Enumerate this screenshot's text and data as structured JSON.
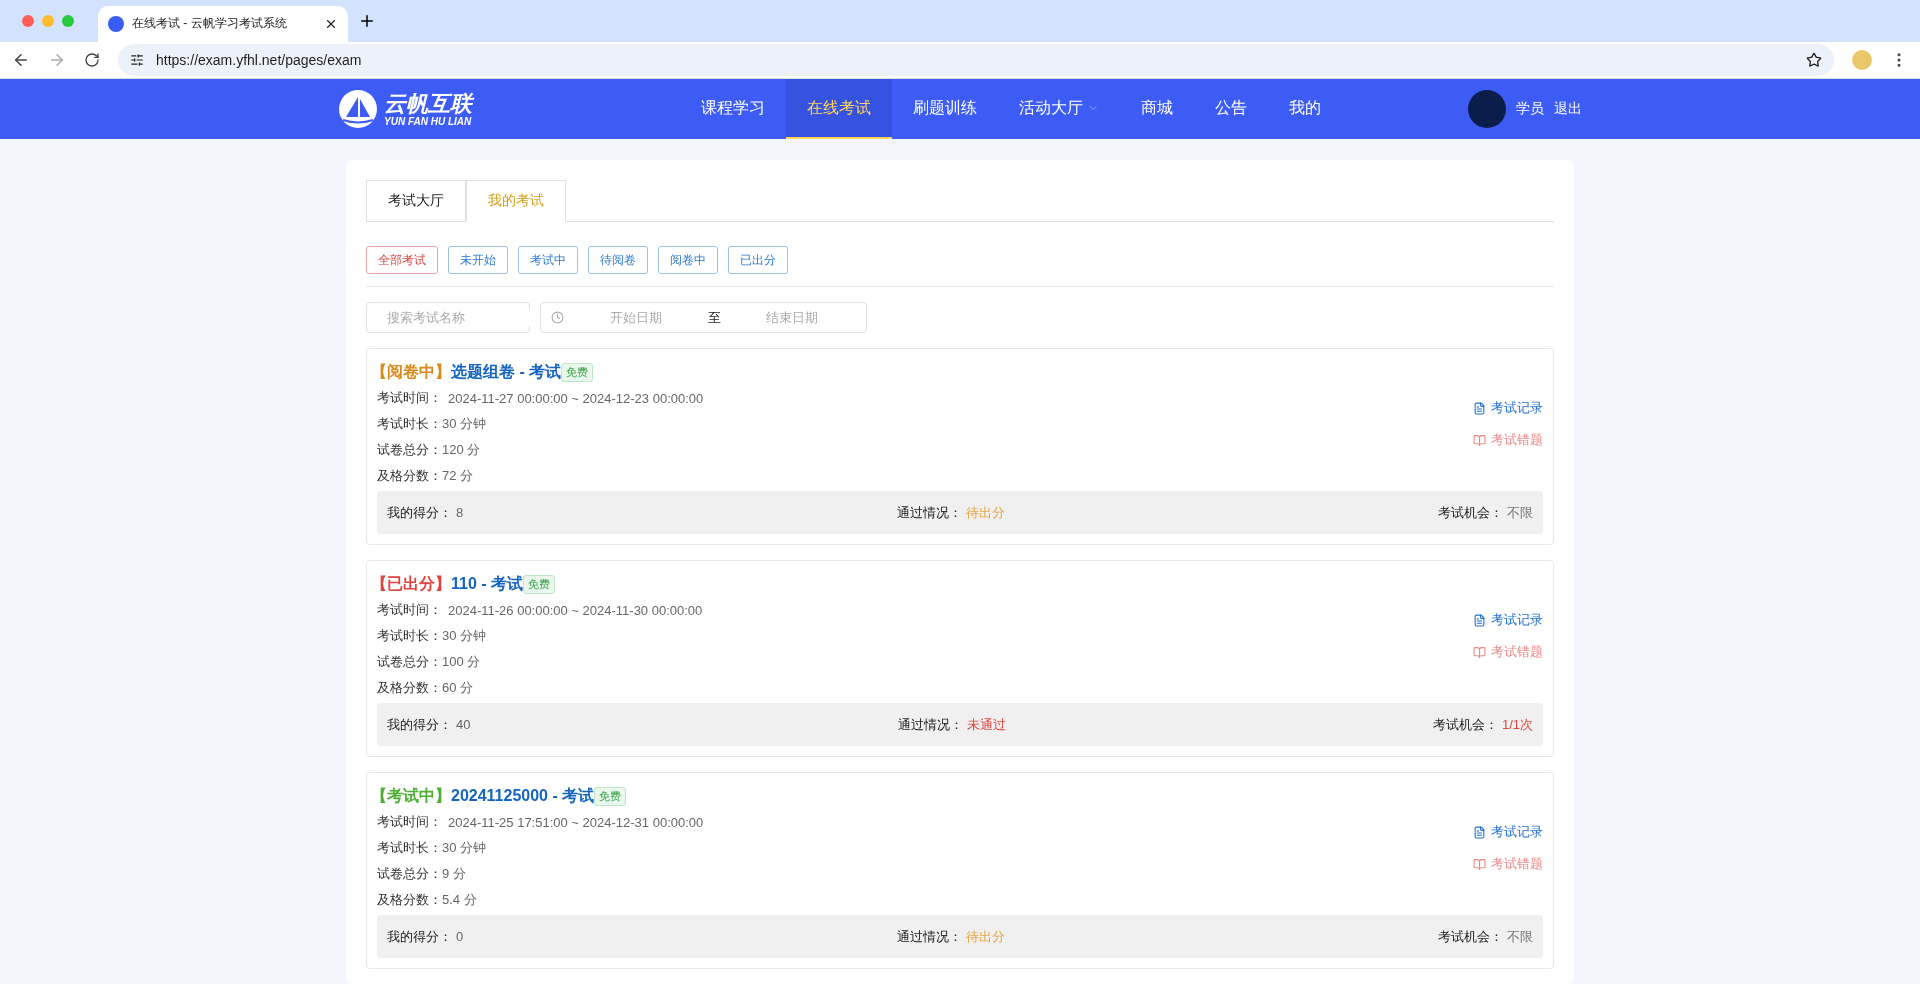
{
  "browser": {
    "tab_title": "在线考试 - 云帆学习考试系统",
    "url": "https://exam.yfhl.net/pages/exam"
  },
  "header": {
    "logo": {
      "title": "云帆互联",
      "subtitle": "YUN FAN HU LIAN"
    },
    "nav": [
      {
        "label": "课程学习",
        "selected": false,
        "kind": "link"
      },
      {
        "label": "在线考试",
        "selected": true,
        "kind": "link"
      },
      {
        "label": "刷题训练",
        "selected": false,
        "kind": "link"
      },
      {
        "label": "活动大厅",
        "selected": false,
        "kind": "dropdown"
      },
      {
        "label": "商城",
        "selected": false,
        "kind": "link"
      },
      {
        "label": "公告",
        "selected": false,
        "kind": "link"
      },
      {
        "label": "我的",
        "selected": false,
        "kind": "link"
      }
    ],
    "user": {
      "role": "学员",
      "logout": "退出"
    }
  },
  "tabs": [
    {
      "label": "考试大厅",
      "selected": false
    },
    {
      "label": "我的考试",
      "selected": true
    }
  ],
  "filters": [
    {
      "label": "全部考试",
      "selected": true
    },
    {
      "label": "未开始",
      "selected": false
    },
    {
      "label": "考试中",
      "selected": false
    },
    {
      "label": "待阅卷",
      "selected": false
    },
    {
      "label": "阅卷中",
      "selected": false
    },
    {
      "label": "已出分",
      "selected": false
    }
  ],
  "search": {
    "placeholder": "搜索考试名称"
  },
  "date_range": {
    "start_placeholder": "开始日期",
    "separator": "至",
    "end_placeholder": "结束日期"
  },
  "exams": [
    {
      "status": {
        "text": "【阅卷中】",
        "color": "#d98a1c"
      },
      "title": "选题组卷 - 考试",
      "tag": "免费",
      "fields": [
        {
          "label": "考试时间：",
          "value": "2024-11-27 00:00:00 ~ 2024-12-23 00:00:00"
        },
        {
          "label": "考试时长：",
          "value": "30 分钟"
        },
        {
          "label": "试卷总分：",
          "value": "120 分"
        },
        {
          "label": "及格分数：",
          "value": "72 分"
        }
      ],
      "actions": [
        {
          "label": "考试记录",
          "kind": "record"
        },
        {
          "label": "考试错题",
          "kind": "mistakes"
        }
      ],
      "score": {
        "label": "我的得分：",
        "value": "8"
      },
      "pass": {
        "label": "通过情况：",
        "value": "待出分",
        "color": "#e6a23c"
      },
      "chances": {
        "label": "考试机会：",
        "value": "不限",
        "color": "#777777"
      }
    },
    {
      "status": {
        "text": "【已出分】",
        "color": "#e0443e"
      },
      "title": "110 - 考试",
      "tag": "免费",
      "fields": [
        {
          "label": "考试时间：",
          "value": "2024-11-26 00:00:00 ~ 2024-11-30 00:00:00"
        },
        {
          "label": "考试时长：",
          "value": "30 分钟"
        },
        {
          "label": "试卷总分：",
          "value": "100 分"
        },
        {
          "label": "及格分数：",
          "value": "60 分"
        }
      ],
      "actions": [
        {
          "label": "考试记录",
          "kind": "record"
        },
        {
          "label": "考试错题",
          "kind": "mistakes"
        }
      ],
      "score": {
        "label": "我的得分：",
        "value": "40"
      },
      "pass": {
        "label": "通过情况：",
        "value": "未通过",
        "color": "#e0443e"
      },
      "chances": {
        "label": "考试机会：",
        "value": "1/1次",
        "color": "#e0443e"
      }
    },
    {
      "status": {
        "text": "【考试中】",
        "color": "#4caf32"
      },
      "title": "20241125000 - 考试",
      "tag": "免费",
      "fields": [
        {
          "label": "考试时间：",
          "value": "2024-11-25 17:51:00 ~ 2024-12-31 00:00:00"
        },
        {
          "label": "考试时长：",
          "value": "30 分钟"
        },
        {
          "label": "试卷总分：",
          "value": "9 分"
        },
        {
          "label": "及格分数：",
          "value": "5.4 分"
        }
      ],
      "actions": [
        {
          "label": "考试记录",
          "kind": "record"
        },
        {
          "label": "考试错题",
          "kind": "mistakes"
        }
      ],
      "score": {
        "label": "我的得分：",
        "value": "0"
      },
      "pass": {
        "label": "通过情况：",
        "value": "待出分",
        "color": "#e6a23c"
      },
      "chances": {
        "label": "考试机会：",
        "value": "不限",
        "color": "#777777"
      }
    }
  ]
}
